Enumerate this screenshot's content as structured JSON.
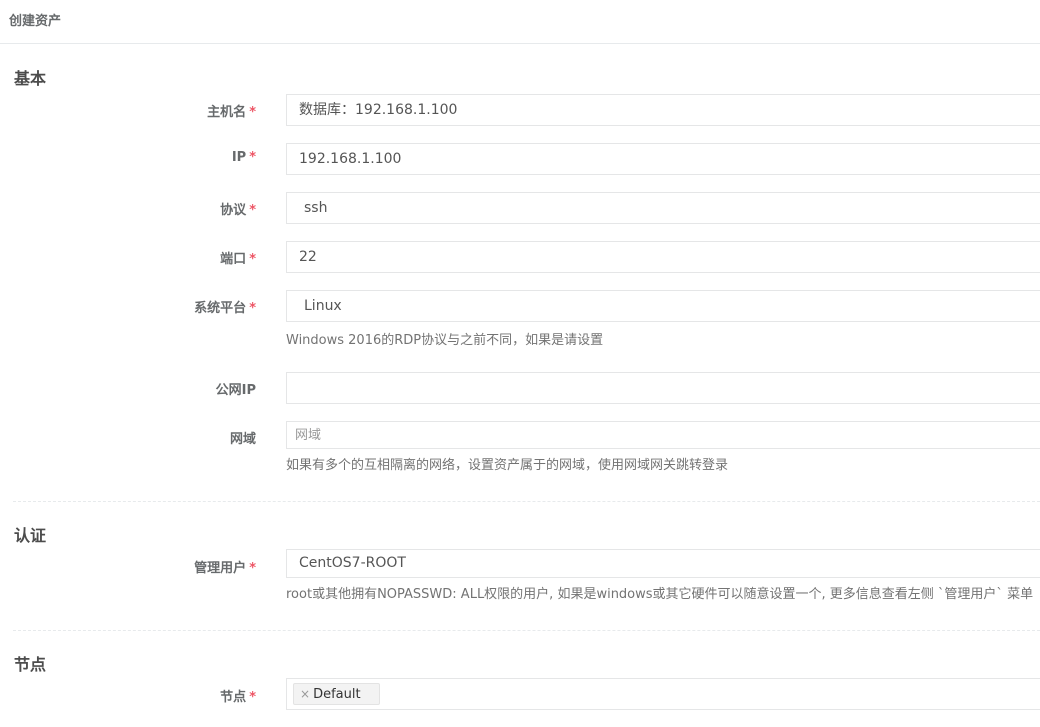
{
  "page": {
    "title": "创建资产"
  },
  "sections": {
    "basic": "基本",
    "auth": "认证",
    "node": "节点"
  },
  "required_mark": "*",
  "fields": {
    "hostname": {
      "label": "主机名",
      "value": "数据库：192.168.1.100"
    },
    "ip": {
      "label": "IP",
      "value": "192.168.1.100"
    },
    "protocol": {
      "label": "协议",
      "value": "ssh"
    },
    "port": {
      "label": "端口",
      "value": "22"
    },
    "platform": {
      "label": "系统平台",
      "value": "Linux",
      "help": "Windows 2016的RDP协议与之前不同，如果是请设置"
    },
    "public_ip": {
      "label": "公网IP",
      "value": ""
    },
    "domain": {
      "label": "网域",
      "placeholder": "网域",
      "help": "如果有多个的互相隔离的网络，设置资产属于的网域，使用网域网关跳转登录"
    },
    "admin_user": {
      "label": "管理用户",
      "value": "CentOS7-ROOT",
      "help": "root或其他拥有NOPASSWD: ALL权限的用户, 如果是windows或其它硬件可以随意设置一个, 更多信息查看左侧 `管理用户` 菜单"
    },
    "nodes": {
      "label": "节点",
      "tags": [
        "Default"
      ],
      "remove_glyph": "×"
    }
  }
}
